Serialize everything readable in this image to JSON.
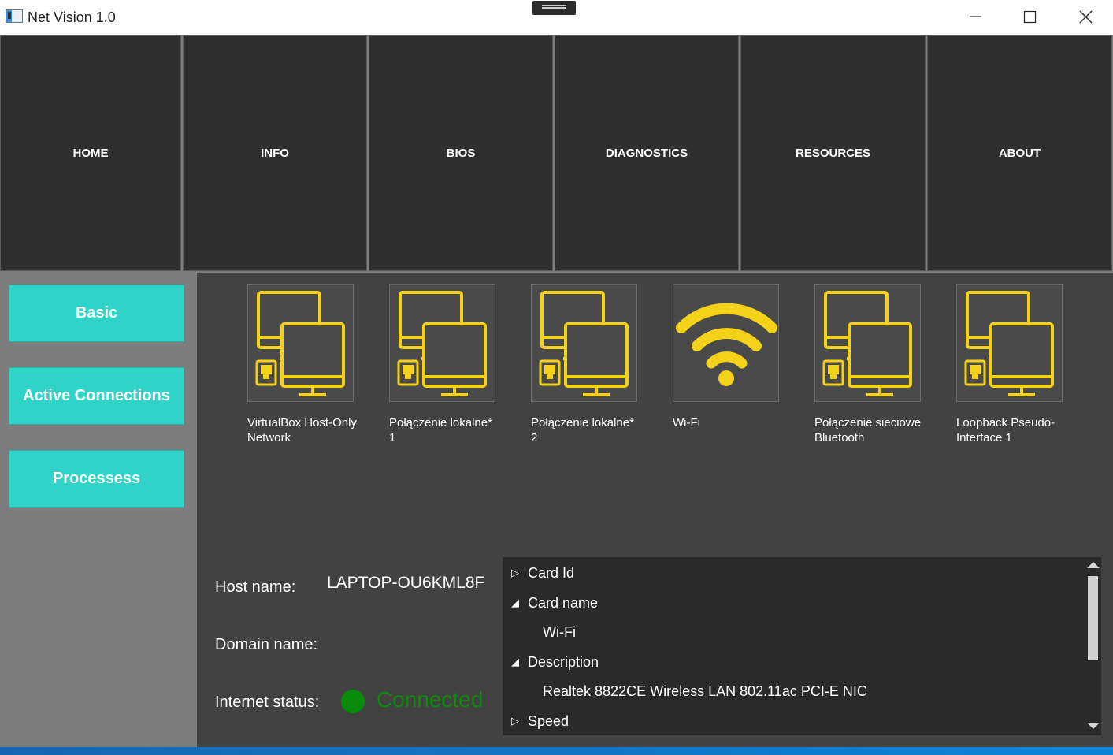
{
  "window": {
    "title": "Net Vision 1.0",
    "controls": [
      "minimize-icon",
      "maximize-icon",
      "close-icon"
    ]
  },
  "topnav": {
    "items": [
      {
        "label": "HOME"
      },
      {
        "label": "INFO"
      },
      {
        "label": "BIOS"
      },
      {
        "label": "DIAGNOSTICS"
      },
      {
        "label": "RESOURCES"
      },
      {
        "label": "ABOUT"
      }
    ]
  },
  "sidebar": {
    "items": [
      {
        "label": "Basic"
      },
      {
        "label": "Active Connections"
      },
      {
        "label": "Processess"
      }
    ]
  },
  "adapters": [
    {
      "name": "VirtualBox Host-Only Network",
      "icon": "network-computers-icon"
    },
    {
      "name": "Połączenie lokalne* 1",
      "icon": "network-computers-icon"
    },
    {
      "name": "Połączenie lokalne* 2",
      "icon": "network-computers-icon"
    },
    {
      "name": "Wi-Fi",
      "icon": "wifi-icon"
    },
    {
      "name": "Połączenie sieciowe Bluetooth",
      "icon": "network-computers-icon"
    },
    {
      "name": "Loopback Pseudo-Interface 1",
      "icon": "network-computers-icon"
    }
  ],
  "host_info": {
    "host_label": "Host name:",
    "host_value": "LAPTOP-OU6KML8F",
    "domain_label": "Domain name:",
    "domain_value": "",
    "status_label": "Internet status:",
    "status_value": "Connected"
  },
  "details_tree": {
    "rows": [
      {
        "label": "Card Id",
        "expanded": false
      },
      {
        "label": "Card name",
        "expanded": true
      },
      {
        "label": "Wi-Fi",
        "child": true
      },
      {
        "label": "Description",
        "expanded": true
      },
      {
        "label": "Realtek 8822CE Wireless LAN 802.11ac PCI-E NIC",
        "child": true
      },
      {
        "label": "Speed",
        "expanded": false
      }
    ]
  },
  "colors": {
    "accent": "#2fd3c8",
    "icon": "#f5d21a",
    "status_ok": "#0a8a0a",
    "panel": "#424242",
    "nav": "#2f2f2f"
  }
}
